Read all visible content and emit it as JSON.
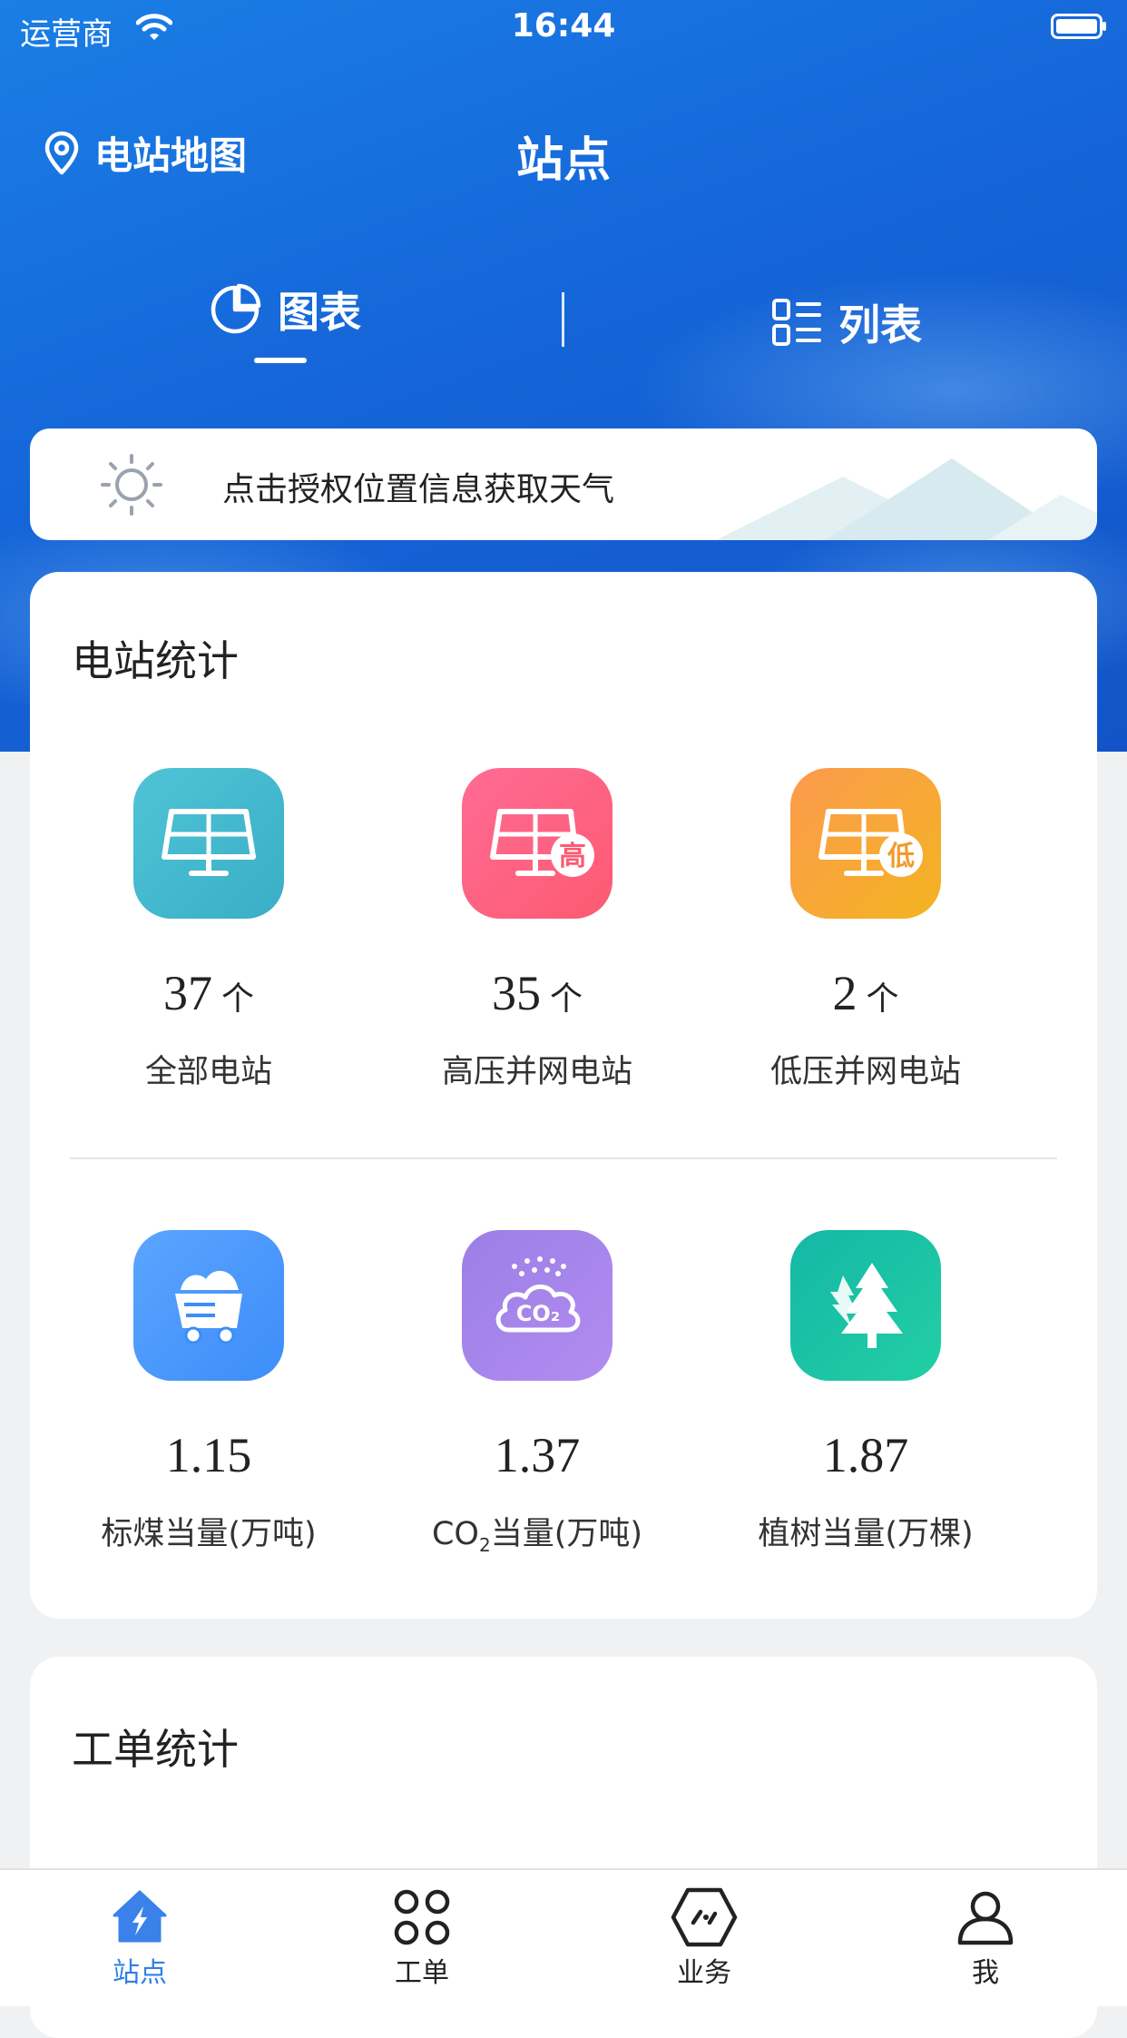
{
  "status_bar": {
    "carrier": "运营商",
    "time": "16:44"
  },
  "nav": {
    "map_link": "电站地图",
    "title": "站点"
  },
  "view_tabs": [
    {
      "label": "图表",
      "icon": "pie-chart-icon",
      "active": true
    },
    {
      "label": "列表",
      "icon": "list-icon",
      "active": false
    }
  ],
  "weather": {
    "text": "点击授权位置信息获取天气",
    "icon": "sun-icon"
  },
  "station_stats": {
    "title": "电站统计",
    "items": [
      {
        "value": "37",
        "unit": "个",
        "label": "全部电站",
        "icon": "solar-panel-icon",
        "colors": [
          "#4fc3d6",
          "#3aaec6"
        ]
      },
      {
        "value": "35",
        "unit": "个",
        "label": "高压并网电站",
        "icon": "solar-panel-high-icon",
        "badge": "高",
        "colors": [
          "#ff6b93",
          "#fd5a72"
        ]
      },
      {
        "value": "2",
        "unit": "个",
        "label": "低压并网电站",
        "icon": "solar-panel-low-icon",
        "badge": "低",
        "colors": [
          "#fca24a",
          "#f3b421"
        ]
      },
      {
        "value": "1.15",
        "label": "标煤当量(万吨)",
        "icon": "coal-cart-icon",
        "colors": [
          "#5aa5ff",
          "#3d8df9"
        ]
      },
      {
        "value": "1.37",
        "label_prefix": "CO",
        "label_sub": "2",
        "label_suffix": "当量(万吨)",
        "icon": "co2-cloud-icon",
        "co2_text": "CO₂",
        "colors": [
          "#9b7fe6",
          "#b28cf0"
        ]
      },
      {
        "value": "1.87",
        "label": "植树当量(万棵)",
        "icon": "tree-icon",
        "colors": [
          "#14b7a6",
          "#22cfa4"
        ]
      }
    ]
  },
  "work_order_stats": {
    "title": "工单统计"
  },
  "tab_bar": [
    {
      "label": "站点",
      "icon": "home-bolt-icon",
      "active": true
    },
    {
      "label": "工单",
      "icon": "grid-icon",
      "active": false
    },
    {
      "label": "业务",
      "icon": "hexagon-icon",
      "active": false
    },
    {
      "label": "我",
      "icon": "person-icon",
      "active": false
    }
  ]
}
